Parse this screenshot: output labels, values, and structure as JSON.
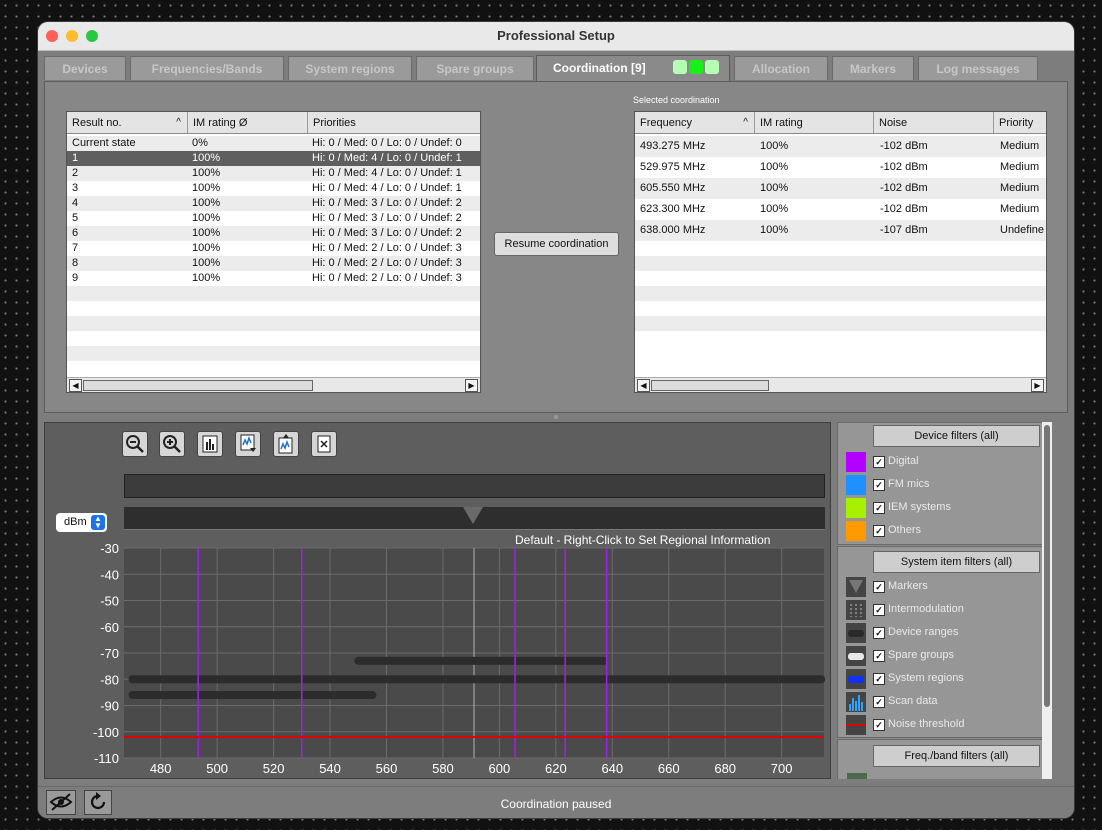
{
  "window": {
    "title": "Professional Setup"
  },
  "tabs": [
    {
      "label": "Devices"
    },
    {
      "label": "Frequencies/Bands"
    },
    {
      "label": "System regions"
    },
    {
      "label": "Spare groups"
    },
    {
      "label": "Coordination [9]"
    },
    {
      "label": "Allocation"
    },
    {
      "label": "Markers"
    },
    {
      "label": "Log messages"
    }
  ],
  "results": {
    "columns": [
      "Result no.",
      "IM rating Ø",
      "Priorities"
    ],
    "rows": [
      {
        "no": "Current state",
        "im": "0%",
        "pri": "Hi: 0 / Med: 0 / Lo: 0 / Undef: 0"
      },
      {
        "no": "1",
        "im": "100%",
        "pri": "Hi: 0 / Med: 4 / Lo: 0 / Undef: 1"
      },
      {
        "no": "2",
        "im": "100%",
        "pri": "Hi: 0 / Med: 4 / Lo: 0 / Undef: 1"
      },
      {
        "no": "3",
        "im": "100%",
        "pri": "Hi: 0 / Med: 4 / Lo: 0 / Undef: 1"
      },
      {
        "no": "4",
        "im": "100%",
        "pri": "Hi: 0 / Med: 3 / Lo: 0 / Undef: 2"
      },
      {
        "no": "5",
        "im": "100%",
        "pri": "Hi: 0 / Med: 3 / Lo: 0 / Undef: 2"
      },
      {
        "no": "6",
        "im": "100%",
        "pri": "Hi: 0 / Med: 3 / Lo: 0 / Undef: 2"
      },
      {
        "no": "7",
        "im": "100%",
        "pri": "Hi: 0 / Med: 2 / Lo: 0 / Undef: 3"
      },
      {
        "no": "8",
        "im": "100%",
        "pri": "Hi: 0 / Med: 2 / Lo: 0 / Undef: 3"
      },
      {
        "no": "9",
        "im": "100%",
        "pri": "Hi: 0 / Med: 2 / Lo: 0 / Undef: 3"
      }
    ]
  },
  "resume_button": "Resume coordination",
  "selected": {
    "heading": "Selected coordination",
    "columns": [
      "Frequency",
      "IM rating",
      "Noise",
      "Priority"
    ],
    "rows": [
      {
        "freq": "493.275 MHz",
        "im": "100%",
        "noise": "-102 dBm",
        "pri": "Medium"
      },
      {
        "freq": "529.975 MHz",
        "im": "100%",
        "noise": "-102 dBm",
        "pri": "Medium"
      },
      {
        "freq": "605.550 MHz",
        "im": "100%",
        "noise": "-102 dBm",
        "pri": "Medium"
      },
      {
        "freq": "623.300 MHz",
        "im": "100%",
        "noise": "-102 dBm",
        "pri": "Medium"
      },
      {
        "freq": "638.000 MHz",
        "im": "100%",
        "noise": "-107 dBm",
        "pri": "Undefine"
      }
    ]
  },
  "spectrum": {
    "unit": "dBm",
    "banner": "Default - Right-Click to Set Regional Information",
    "icons": [
      "zoom-out-icon",
      "zoom-in-icon",
      "report-icon",
      "import-scan-icon",
      "export-scan-icon",
      "clear-icon"
    ],
    "colors": {
      "grid": "#6c6c6c",
      "marker": "#a020f0",
      "noise": "#e00000",
      "range": "#2c2c2c"
    }
  },
  "chart_data": {
    "type": "line",
    "xlim": [
      467,
      715
    ],
    "ylim": [
      -110,
      -30
    ],
    "xticks": [
      480,
      500,
      520,
      540,
      560,
      580,
      600,
      620,
      640,
      660,
      680,
      700
    ],
    "yticks": [
      -30,
      -40,
      -50,
      -60,
      -70,
      -80,
      -90,
      -100,
      -110
    ],
    "markers_mhz": [
      493.275,
      529.975,
      605.55,
      623.3,
      638.0
    ],
    "noise_threshold_dbm": -102,
    "device_ranges": [
      {
        "start": 470,
        "end": 714,
        "level": -80
      },
      {
        "start": 470,
        "end": 555,
        "level": -86
      },
      {
        "start": 550,
        "end": 637,
        "level": -73
      }
    ]
  },
  "filters": {
    "device_title": "Device filters (all)",
    "device": [
      {
        "label": "Digital",
        "color": "#b400ff"
      },
      {
        "label": "FM mics",
        "color": "#1e90ff"
      },
      {
        "label": "IEM systems",
        "color": "#a8f000"
      },
      {
        "label": "Others",
        "color": "#ff9a00"
      }
    ],
    "system_title": "System item filters (all)",
    "system": [
      {
        "label": "Markers",
        "icon": "marker-icon"
      },
      {
        "label": "Intermodulation",
        "icon": "intermodulation-icon"
      },
      {
        "label": "Device ranges",
        "icon": "device-range-icon"
      },
      {
        "label": "Spare groups",
        "icon": "spare-group-icon"
      },
      {
        "label": "System regions",
        "icon": "system-region-icon"
      },
      {
        "label": "Scan data",
        "icon": "scan-data-icon"
      },
      {
        "label": "Noise threshold",
        "icon": "noise-threshold-icon"
      }
    ],
    "freq_title": "Freq./band filters (all)",
    "check": "✓"
  },
  "status": {
    "text": "Coordination paused"
  }
}
